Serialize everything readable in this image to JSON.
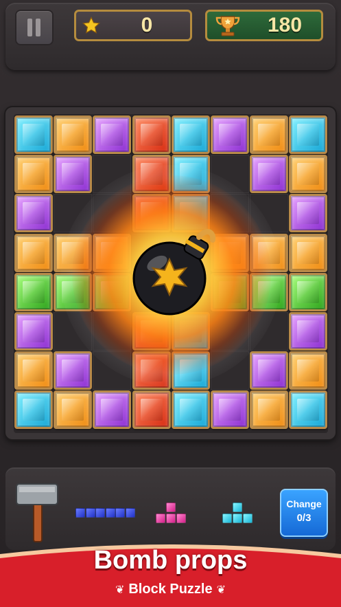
{
  "hud": {
    "score": "0",
    "best_score": "180",
    "icons": {
      "pause": "pause-icon",
      "star": "star-icon",
      "trophy": "trophy-icon"
    }
  },
  "board": {
    "rows": [
      [
        "cyan",
        "orange",
        "purple",
        "red",
        "cyan",
        "purple",
        "orange",
        "cyan"
      ],
      [
        "orange",
        "purple",
        "empty",
        "red",
        "cyan",
        "empty",
        "purple",
        "orange"
      ],
      [
        "purple",
        "empty",
        "empty",
        "red",
        "cyan",
        "empty",
        "empty",
        "purple"
      ],
      [
        "orange",
        "orange",
        "orange",
        "empty",
        "empty",
        "orange",
        "orange",
        "orange"
      ],
      [
        "green",
        "green",
        "green",
        "empty",
        "empty",
        "green",
        "green",
        "green"
      ],
      [
        "purple",
        "empty",
        "empty",
        "red",
        "cyan",
        "empty",
        "empty",
        "purple"
      ],
      [
        "orange",
        "purple",
        "empty",
        "red",
        "cyan",
        "empty",
        "purple",
        "orange"
      ],
      [
        "cyan",
        "orange",
        "purple",
        "red",
        "cyan",
        "purple",
        "orange",
        "cyan"
      ]
    ],
    "effect": "bomb-explosion"
  },
  "tray": {
    "hammer": "hammer-icon",
    "pieces": [
      "blue 1x5 line",
      "pink pyramid",
      "aqua pyramid"
    ],
    "change_label": "Change",
    "change_count": "0/3"
  },
  "banner": {
    "title": "Bomb props",
    "subtitle": "Block Puzzle"
  },
  "colors": {
    "cyan": "#16a6d6",
    "orange": "#f08a10",
    "purple": "#8a2bd1",
    "red": "#d62a10",
    "green": "#2ba21a",
    "banner_red": "#d81f2a",
    "gold_border": "#b58c3e"
  }
}
